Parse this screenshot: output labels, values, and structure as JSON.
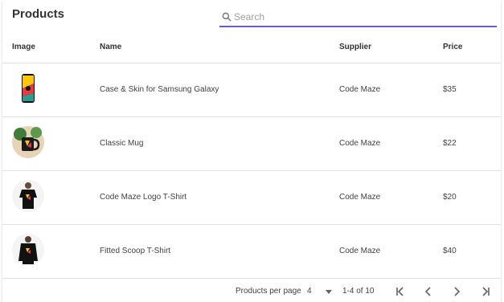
{
  "header": {
    "title": "Products"
  },
  "search": {
    "placeholder": "Search",
    "value": ""
  },
  "columns": {
    "image": "Image",
    "name": "Name",
    "supplier": "Supplier",
    "price": "Price"
  },
  "rows": [
    {
      "name": "Case & Skin for Samsung Galaxy",
      "supplier": "Code Maze",
      "price": "$35",
      "image_icon": "phone-case-icon"
    },
    {
      "name": "Classic Mug",
      "supplier": "Code Maze",
      "price": "$22",
      "image_icon": "mug-icon"
    },
    {
      "name": "Code Maze Logo T-Shirt",
      "supplier": "Code Maze",
      "price": "$20",
      "image_icon": "tshirt-icon"
    },
    {
      "name": "Fitted Scoop T-Shirt",
      "supplier": "Code Maze",
      "price": "$40",
      "image_icon": "hoodie-icon"
    }
  ],
  "pagination": {
    "per_page_label": "Products per page",
    "per_page_value": "4",
    "range": "1-4 of 10"
  },
  "colors": {
    "accent": "#6a5acd",
    "border": "#e0e0e0"
  }
}
